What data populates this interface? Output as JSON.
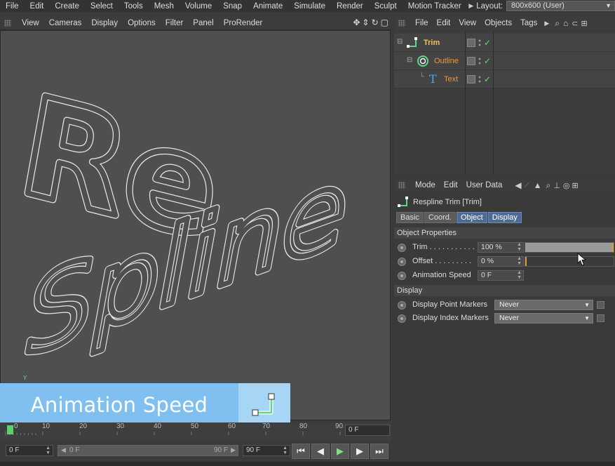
{
  "menubar": {
    "items": [
      "File",
      "Edit",
      "Create",
      "Select",
      "Tools",
      "Mesh",
      "Volume",
      "Snap",
      "Animate",
      "Simulate",
      "Render",
      "Sculpt",
      "Motion Tracker"
    ],
    "layout_label": "Layout:",
    "layout_value": "800x600 (User)"
  },
  "viewport": {
    "menu": [
      "View",
      "Cameras",
      "Display",
      "Options",
      "Filter",
      "Panel",
      "ProRender"
    ],
    "axis_label": "Y"
  },
  "title_card": {
    "text": "Animation Speed",
    "accent_color": "#7fc0f0",
    "icon": "respline-trim-icon"
  },
  "timeline": {
    "ticks": [
      "0",
      "10",
      "20",
      "30",
      "40",
      "50",
      "60",
      "70",
      "80",
      "90"
    ],
    "current_frame": "0 F",
    "start_field": "0 F",
    "range_start": "0 F",
    "range_end": "90 F",
    "end_field": "90 F",
    "playhead_frame": 0
  },
  "objects_manager": {
    "menu": [
      "File",
      "Edit",
      "View",
      "Objects",
      "Tags"
    ],
    "objects": [
      {
        "name": "Trim",
        "icon": "trim-spline-icon",
        "color": "#f0c060"
      },
      {
        "name": "Outline",
        "icon": "outline-ring-icon",
        "color": "#e69a3a"
      },
      {
        "name": "Text",
        "icon": "text-t-icon",
        "color": "#e69a3a"
      }
    ]
  },
  "attributes": {
    "menu": [
      "Mode",
      "Edit",
      "User Data"
    ],
    "header": "Respline Trim [Trim]",
    "tabs": [
      "Basic",
      "Coord.",
      "Object",
      "Display"
    ],
    "active_tabs": [
      "Object",
      "Display"
    ],
    "section_object": "Object Properties",
    "props": [
      {
        "label": "Trim . . . . . . . . . . .",
        "value": "100 %",
        "fill": 1.0
      },
      {
        "label": "Offset . . . . . . . . .",
        "value": "0 %",
        "fill": 0.0
      },
      {
        "label": "Animation Speed",
        "value": "0 F"
      }
    ],
    "section_display": "Display",
    "display_props": [
      {
        "label": "Display Point Markers",
        "value": "Never"
      },
      {
        "label": "Display Index Markers",
        "value": "Never"
      }
    ]
  }
}
